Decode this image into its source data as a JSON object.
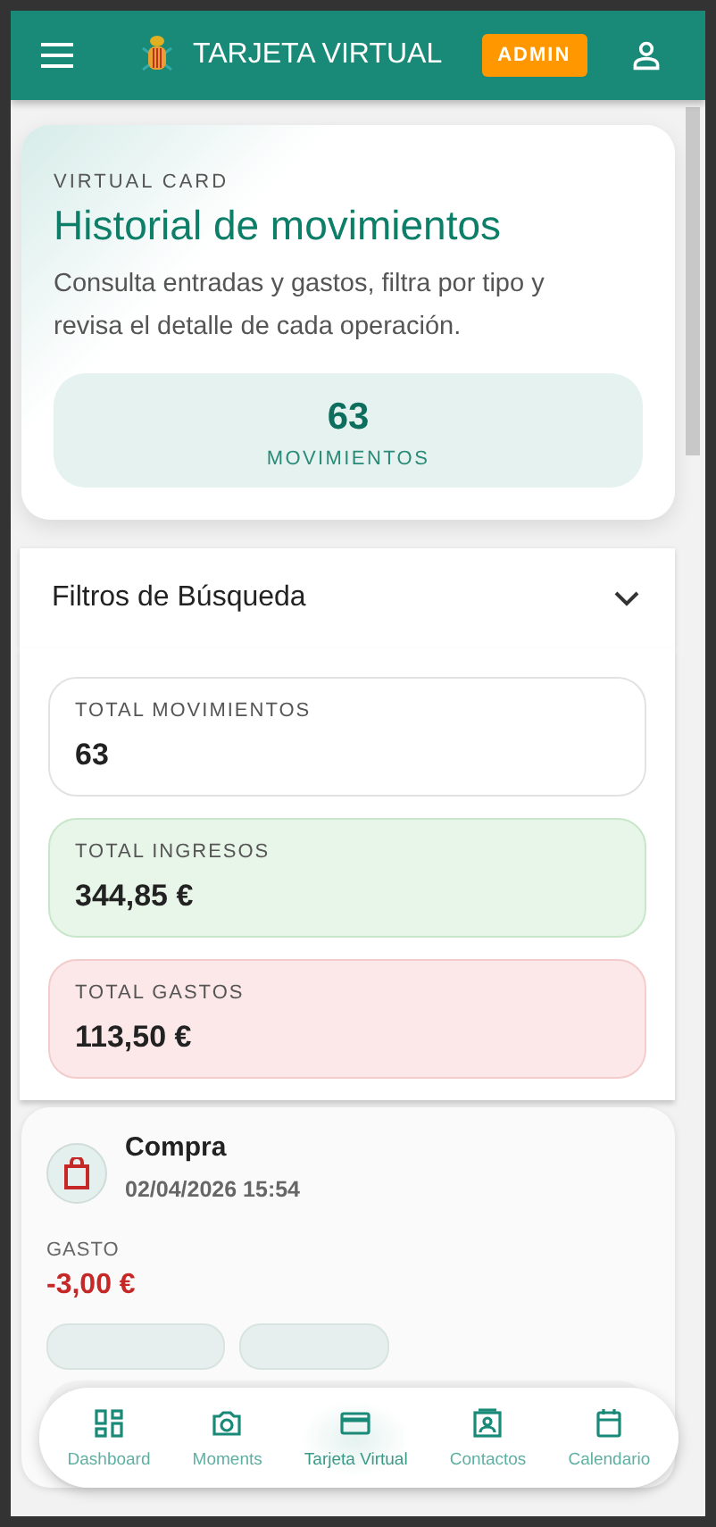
{
  "header": {
    "title": "TARJETA VIRTUAL",
    "badge": "ADMIN"
  },
  "hero": {
    "eyebrow": "VIRTUAL CARD",
    "title": "Historial de movimientos",
    "description": "Consulta entradas y gastos, filtra por tipo y revisa el detalle de cada operación.",
    "count": "63",
    "count_label": "MOVIMIENTOS"
  },
  "filters": {
    "title": "Filtros de Búsqueda",
    "expanded": false
  },
  "totals": [
    {
      "label": "TOTAL MOVIMIENTOS",
      "value": "63",
      "kind": "neutral"
    },
    {
      "label": "TOTAL INGRESOS",
      "value": "344,85 €",
      "kind": "income"
    },
    {
      "label": "TOTAL GASTOS",
      "value": "113,50 €",
      "kind": "expense"
    }
  ],
  "movements": [
    {
      "title": "Compra",
      "date": "02/04/2026 15:54",
      "type": "GASTO",
      "amount": "-3,00 €",
      "kind": "expense"
    }
  ],
  "bottom_nav": [
    {
      "label": "Dashboard",
      "kind": "dashboard",
      "selected": false
    },
    {
      "label": "Moments",
      "kind": "camera",
      "selected": false
    },
    {
      "label": "Tarjeta Virtual",
      "kind": "card",
      "selected": true
    },
    {
      "label": "Contactos",
      "kind": "contact",
      "selected": false
    },
    {
      "label": "Calendario",
      "kind": "calendar",
      "selected": false
    }
  ]
}
